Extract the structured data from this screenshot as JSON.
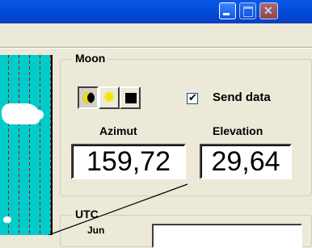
{
  "window": {
    "controls": [
      "minimize-icon",
      "maximize-icon",
      "close-icon"
    ]
  },
  "moon_panel": {
    "title": "Moon",
    "mode_buttons": [
      {
        "name": "moon-icon",
        "active": true
      },
      {
        "name": "sun-icon",
        "active": false
      },
      {
        "name": "grid-icon",
        "active": false
      }
    ],
    "send_data": {
      "label": "Send data",
      "checked": true
    },
    "azimut": {
      "label": "Azimut",
      "value": "159,72"
    },
    "elevation": {
      "label": "Elevation",
      "value": "29,64"
    }
  },
  "utc_panel": {
    "title": "UTC",
    "sub_label": "Jun"
  },
  "colors": {
    "map_background": "#00cccc",
    "map_grid": "#c00000",
    "titlebar": "#0054e3"
  }
}
